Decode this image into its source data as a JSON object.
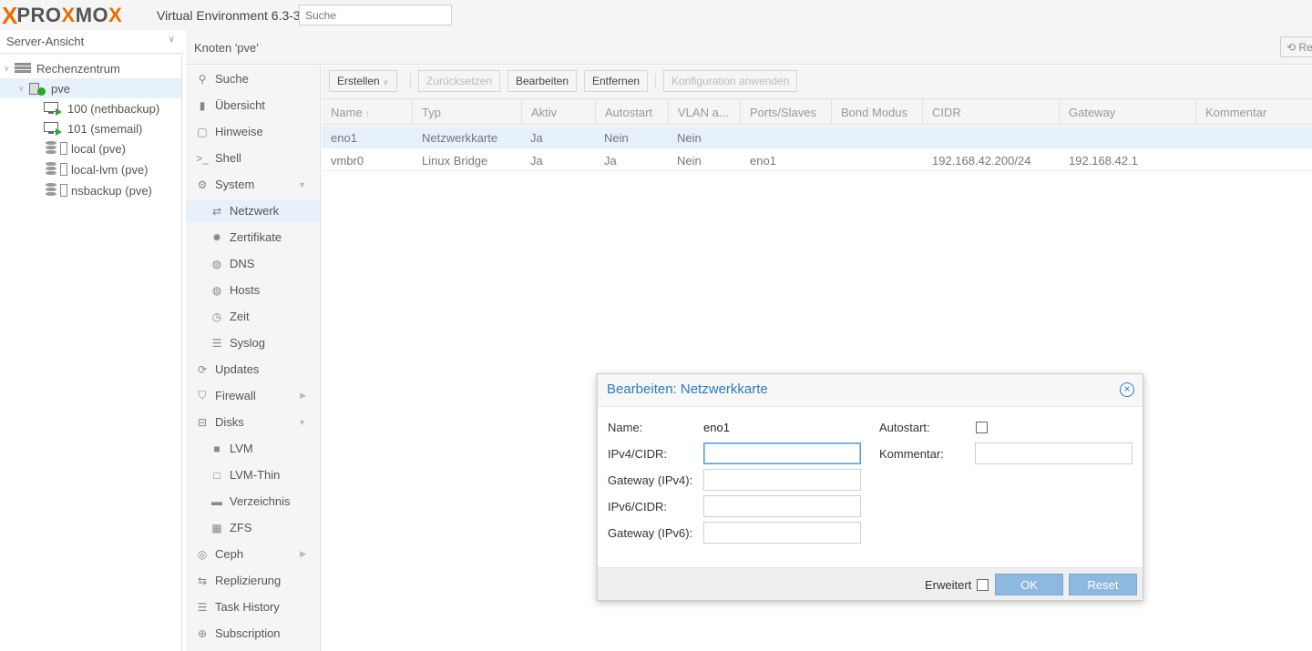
{
  "app": {
    "logo_text_1": "PRO",
    "logo_x": "X",
    "logo_text_2": "MO",
    "logo_text_3": "X",
    "version": "Virtual Environment 6.3-3",
    "search_placeholder": "Suche"
  },
  "sidebar": {
    "view": "Server-Ansicht",
    "tree": [
      {
        "label": "Rechenzentrum",
        "type": "datacenter"
      },
      {
        "label": "pve",
        "type": "node",
        "selected": true
      },
      {
        "label": "100 (nethbackup)",
        "type": "vm"
      },
      {
        "label": "101 (smemail)",
        "type": "vm"
      },
      {
        "label": "local (pve)",
        "type": "storage"
      },
      {
        "label": "local-lvm (pve)",
        "type": "storage"
      },
      {
        "label": "nsbackup (pve)",
        "type": "storage"
      }
    ]
  },
  "header": {
    "title": "Knoten 'pve'",
    "reload": "Re"
  },
  "menu": [
    {
      "label": "Suche",
      "icon": "search-icon",
      "glyph": "⚲"
    },
    {
      "label": "Übersicht",
      "icon": "book-icon",
      "glyph": "▮"
    },
    {
      "label": "Hinweise",
      "icon": "note-icon",
      "glyph": "▢"
    },
    {
      "label": "Shell",
      "icon": "terminal-icon",
      "glyph": ">_"
    },
    {
      "label": "System",
      "icon": "cogs-icon",
      "glyph": "⚙"
    },
    {
      "label": "Netzwerk",
      "icon": "exchange-icon",
      "glyph": "⇄"
    },
    {
      "label": "Zertifikate",
      "icon": "certificate-icon",
      "glyph": "✹"
    },
    {
      "label": "DNS",
      "icon": "globe-icon",
      "glyph": "◍"
    },
    {
      "label": "Hosts",
      "icon": "globe-icon",
      "glyph": "◍"
    },
    {
      "label": "Zeit",
      "icon": "clock-icon",
      "glyph": "◷"
    },
    {
      "label": "Syslog",
      "icon": "list-icon",
      "glyph": "☰"
    },
    {
      "label": "Updates",
      "icon": "refresh-icon",
      "glyph": "⟳"
    },
    {
      "label": "Firewall",
      "icon": "shield-icon",
      "glyph": "⛉"
    },
    {
      "label": "Disks",
      "icon": "hdd-icon",
      "glyph": "⊟"
    },
    {
      "label": "LVM",
      "icon": "square-icon",
      "glyph": "■"
    },
    {
      "label": "LVM-Thin",
      "icon": "square-outline-icon",
      "glyph": "□"
    },
    {
      "label": "Verzeichnis",
      "icon": "folder-icon",
      "glyph": "▬"
    },
    {
      "label": "ZFS",
      "icon": "th-large-icon",
      "glyph": "▦"
    },
    {
      "label": "Ceph",
      "icon": "ceph-icon",
      "glyph": "◎"
    },
    {
      "label": "Replizierung",
      "icon": "retweet-icon",
      "glyph": "⇆"
    },
    {
      "label": "Task History",
      "icon": "list-alt-icon",
      "glyph": "☰"
    },
    {
      "label": "Subscription",
      "icon": "support-icon",
      "glyph": "⊕"
    }
  ],
  "toolbar": {
    "create": "Erstellen",
    "revert": "Zurücksetzen",
    "edit": "Bearbeiten",
    "remove": "Entfernen",
    "apply": "Konfiguration anwenden"
  },
  "grid": {
    "columns": [
      "Name",
      "Typ",
      "Aktiv",
      "Autostart",
      "VLAN a...",
      "Ports/Slaves",
      "Bond Modus",
      "CIDR",
      "Gateway",
      "Kommentar"
    ],
    "sort_indicator": "↑",
    "rows": [
      [
        "eno1",
        "Netzwerkkarte",
        "Ja",
        "Nein",
        "Nein",
        "",
        "",
        "",
        "",
        ""
      ],
      [
        "vmbr0",
        "Linux Bridge",
        "Ja",
        "Ja",
        "Nein",
        "eno1",
        "",
        "192.168.42.200/24",
        "192.168.42.1",
        ""
      ]
    ]
  },
  "dialog": {
    "title": "Bearbeiten: Netzwerkkarte",
    "close": "×",
    "name_label": "Name:",
    "name_value": "eno1",
    "ipv4_label": "IPv4/CIDR:",
    "ipv4_value": "",
    "gw4_label": "Gateway (IPv4):",
    "gw4_value": "",
    "ipv6_label": "IPv6/CIDR:",
    "ipv6_value": "",
    "gw6_label": "Gateway (IPv6):",
    "gw6_value": "",
    "autostart_label": "Autostart:",
    "autostart_checked": false,
    "comment_label": "Kommentar:",
    "comment_value": "",
    "advanced_label": "Erweitert",
    "advanced_checked": false,
    "ok": "OK",
    "reset": "Reset"
  }
}
